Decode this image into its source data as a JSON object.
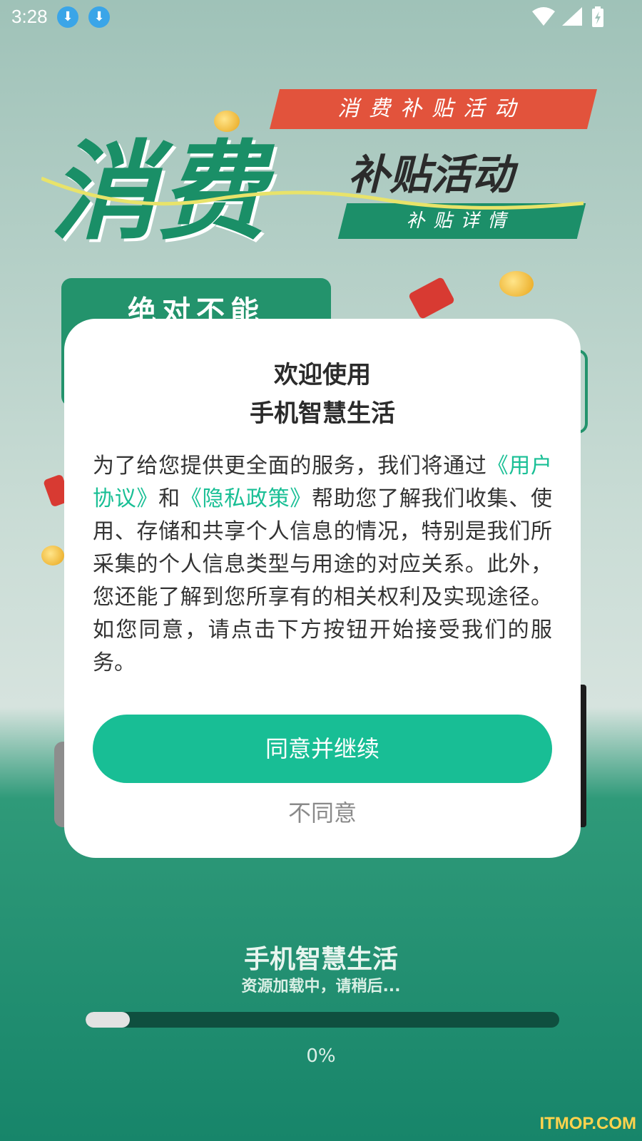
{
  "status_bar": {
    "time": "3:28",
    "download_icons": [
      "download-icon",
      "download-icon"
    ],
    "right_icons": [
      "wifi-icon",
      "signal-icon",
      "battery-charging-icon"
    ]
  },
  "banner": {
    "tag": "消费补贴活动",
    "title_big": "消费",
    "title_sub": "补贴活动",
    "detail": "补贴详情",
    "card_text": "绝对不能"
  },
  "dialog": {
    "title_line1": "欢迎使用",
    "title_line2": "手机智慧生活",
    "body_part1": "为了给您提供更全面的服务，我们将通过",
    "link_user_agreement": "《用户协议》",
    "body_and": "和",
    "link_privacy_policy": "《隐私政策》",
    "body_part2": "帮助您了解我们收集、使用、存储和共享个人信息的情况，特别是我们所采集的个人信息类型与用途的对应关系。此外，您还能了解到您所享有的相关权利及实现途径。如您同意，请点击下方按钮开始接受我们的服务。",
    "agree_button": "同意并继续",
    "disagree_button": "不同意"
  },
  "footer": {
    "app_name": "手机智慧生活",
    "loading_text": "资源加载中，请稍后...",
    "progress_value": 0,
    "progress_label": "0%"
  },
  "watermark": "ITMOP.COM",
  "colors": {
    "accent": "#18be95",
    "link": "#19bf95",
    "banner_green": "#1a8f67",
    "tag_red": "#e2533c"
  }
}
